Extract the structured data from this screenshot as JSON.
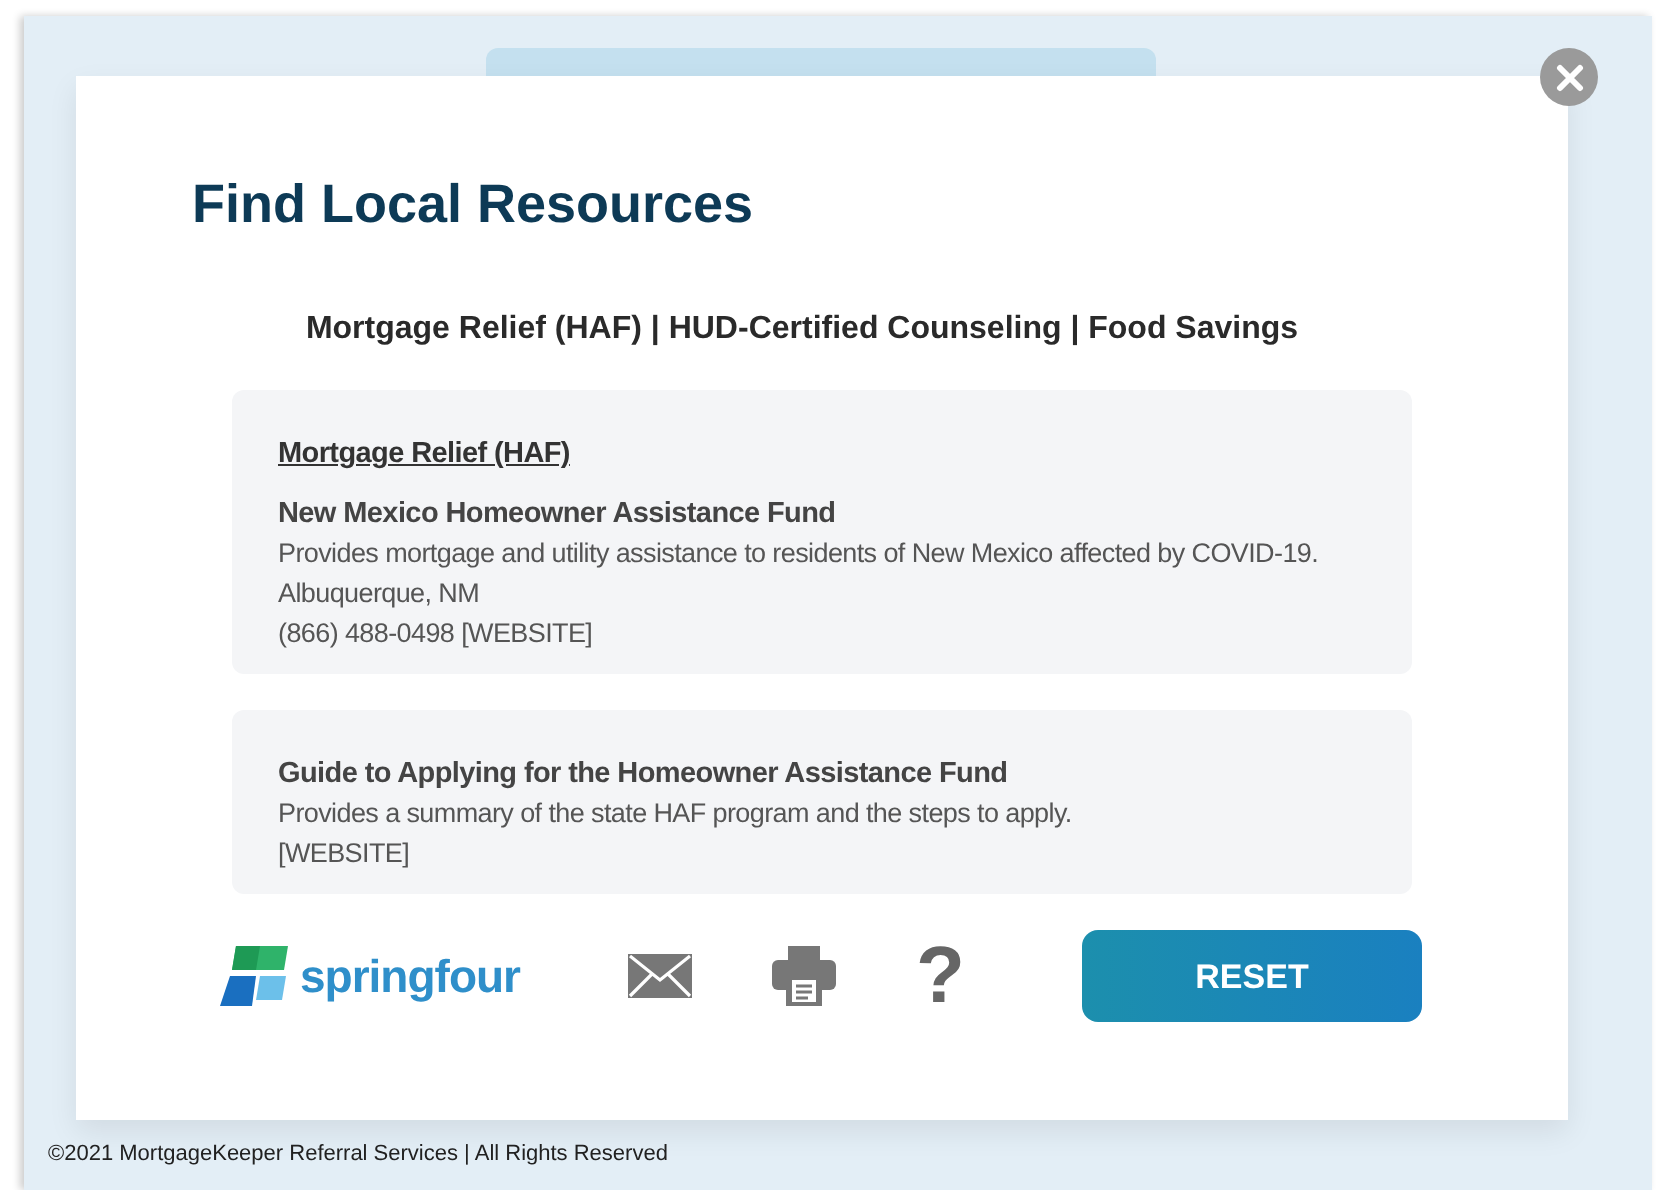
{
  "title": "Find Local Resources",
  "category_nav": "Mortgage Relief (HAF) | HUD-Certified Counseling | Food Savings",
  "cards": [
    {
      "heading": "Mortgage Relief (HAF) ",
      "name": "New Mexico Homeowner Assistance Fund",
      "lines": [
        "Provides mortgage and utility assistance to residents of New Mexico affected by COVID-19.",
        "Albuquerque, NM",
        "(866) 488-0498 [WEBSITE]"
      ]
    },
    {
      "name": "Guide to Applying for the Homeowner Assistance Fund",
      "lines": [
        "Provides a summary of the state HAF program and the steps to apply.",
        "[WEBSITE]"
      ]
    }
  ],
  "logo": "springfour",
  "help_glyph": "?",
  "reset_button": "RESET",
  "footer": "©2021 MortgageKeeper Referral Services | All Rights Reserved"
}
